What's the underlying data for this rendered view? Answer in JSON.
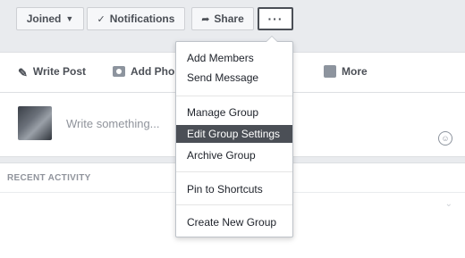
{
  "header": {
    "joined_label": "Joined",
    "notifications_label": "Notifications",
    "share_label": "Share",
    "more_label": "···"
  },
  "composer": {
    "write_post": "Write Post",
    "add_photo": "Add Pho",
    "more": "More",
    "placeholder": "Write something..."
  },
  "activity": {
    "title": "RECENT ACTIVITY"
  },
  "menu": {
    "items": [
      "Add Members",
      "Send Message",
      "Manage Group",
      "Edit Group Settings",
      "Archive Group",
      "Pin to Shortcuts",
      "Create New Group"
    ],
    "highlighted": "Edit Group Settings"
  },
  "colors": {
    "highlight": "#4b4f56",
    "page_bg": "#e9ebee"
  }
}
